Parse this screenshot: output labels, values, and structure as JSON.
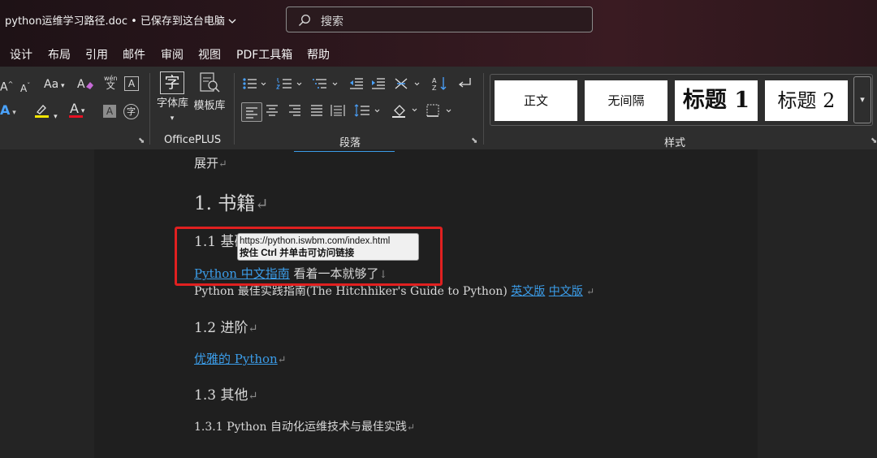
{
  "titlebar": {
    "doc_title": "python运维学习路径.doc • 已保存到这台电脑",
    "search_placeholder": "搜索"
  },
  "menu": {
    "tabs": [
      "设计",
      "布局",
      "引用",
      "邮件",
      "审阅",
      "视图",
      "PDF工具箱",
      "帮助"
    ]
  },
  "ribbon": {
    "font_grow": "A",
    "font_shrink": "A",
    "change_case": "Aa",
    "phonetic_top": "wén",
    "phonetic_bottom": "文",
    "char_border": "A",
    "text_effects": "A",
    "font_color": "A",
    "char_shading": "A",
    "enclose_char": "字",
    "highlight_color": "#f2e600",
    "font_color_value": "#e81123",
    "officeplus": {
      "font_library_glyph": "字",
      "font_library": "字体库",
      "template_library": "模板库",
      "group_label": "OfficePLUS"
    },
    "paragraph_group_label": "段落",
    "styles": {
      "tiles": [
        "正文",
        "无间隔",
        "标题 1",
        "标题 2"
      ],
      "group_label": "样式"
    }
  },
  "document": {
    "expand_text": "展开",
    "heading1": "1.  书籍",
    "h11_prefix": "1.1  基",
    "h11_suffix": "础",
    "line1_link": "Python 中文指南",
    "line1_text": " 看着一本就够了",
    "line1_mark": "↓",
    "line2_text": "Python 最佳实践指南(The Hitchhiker's Guide to Python) ",
    "line2_link1": "英文版",
    "line2_link2": "中文版",
    "h12": "1.2  进阶",
    "line3_link": "优雅的 Python",
    "h13": "1.3  其他",
    "h131": "1.3.1 Python 自动化运维技术与最佳实践",
    "para_mark": "↵"
  },
  "tooltip": {
    "url": "https://python.iswbm.com/index.html",
    "hint": "按住 Ctrl 并单击可访问链接"
  },
  "colors": {
    "link": "#3b9ce8",
    "annotation_box": "#e02020"
  }
}
